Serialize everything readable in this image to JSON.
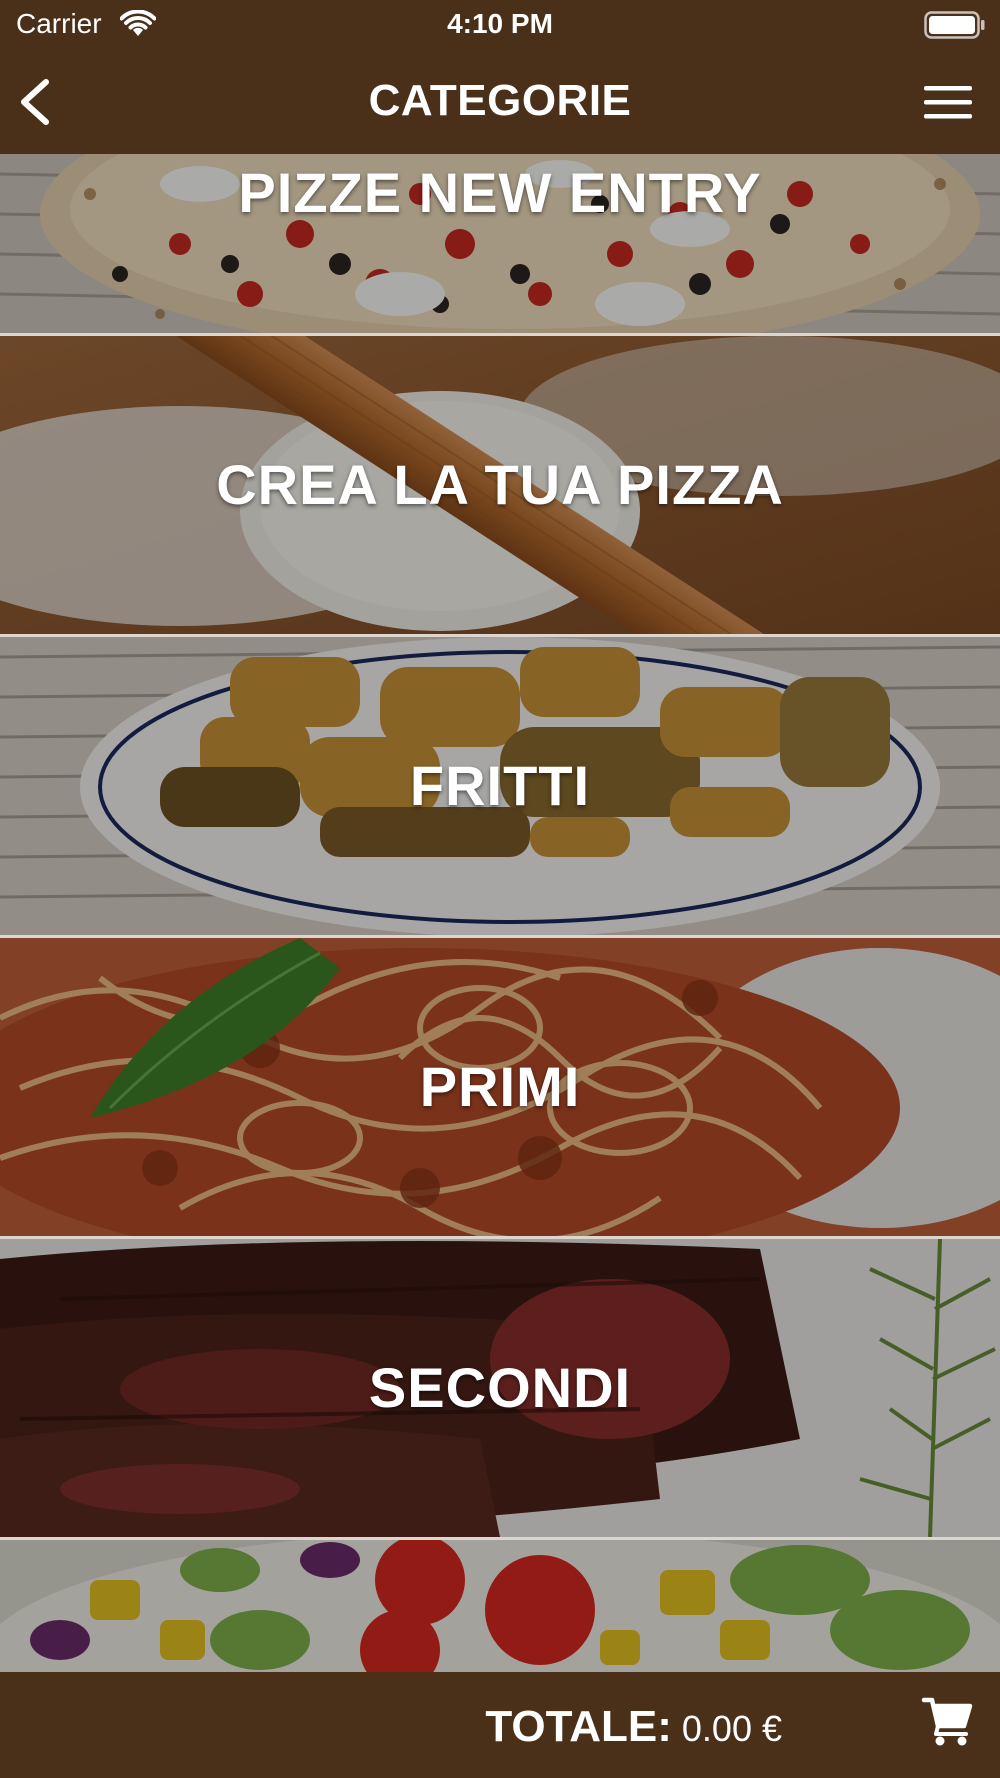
{
  "status_bar": {
    "carrier": "Carrier",
    "time": "4:10 PM",
    "icons": [
      "wifi-icon",
      "battery-icon"
    ]
  },
  "nav": {
    "title": "CATEGORIE",
    "back_icon": "chevron-left-icon",
    "menu_icon": "hamburger-menu-icon"
  },
  "categories": [
    {
      "label": "PIZZE NEW ENTRY"
    },
    {
      "label": "CREA LA TUA PIZZA"
    },
    {
      "label": "FRITTI"
    },
    {
      "label": "PRIMI"
    },
    {
      "label": "SECONDI"
    },
    {
      "label": ""
    }
  ],
  "footer": {
    "total_label": "TOTALE:",
    "total_value": "0.00 €",
    "cart_icon": "cart-icon"
  },
  "colors": {
    "bar_background": "#4a3019",
    "text": "#ffffff"
  }
}
